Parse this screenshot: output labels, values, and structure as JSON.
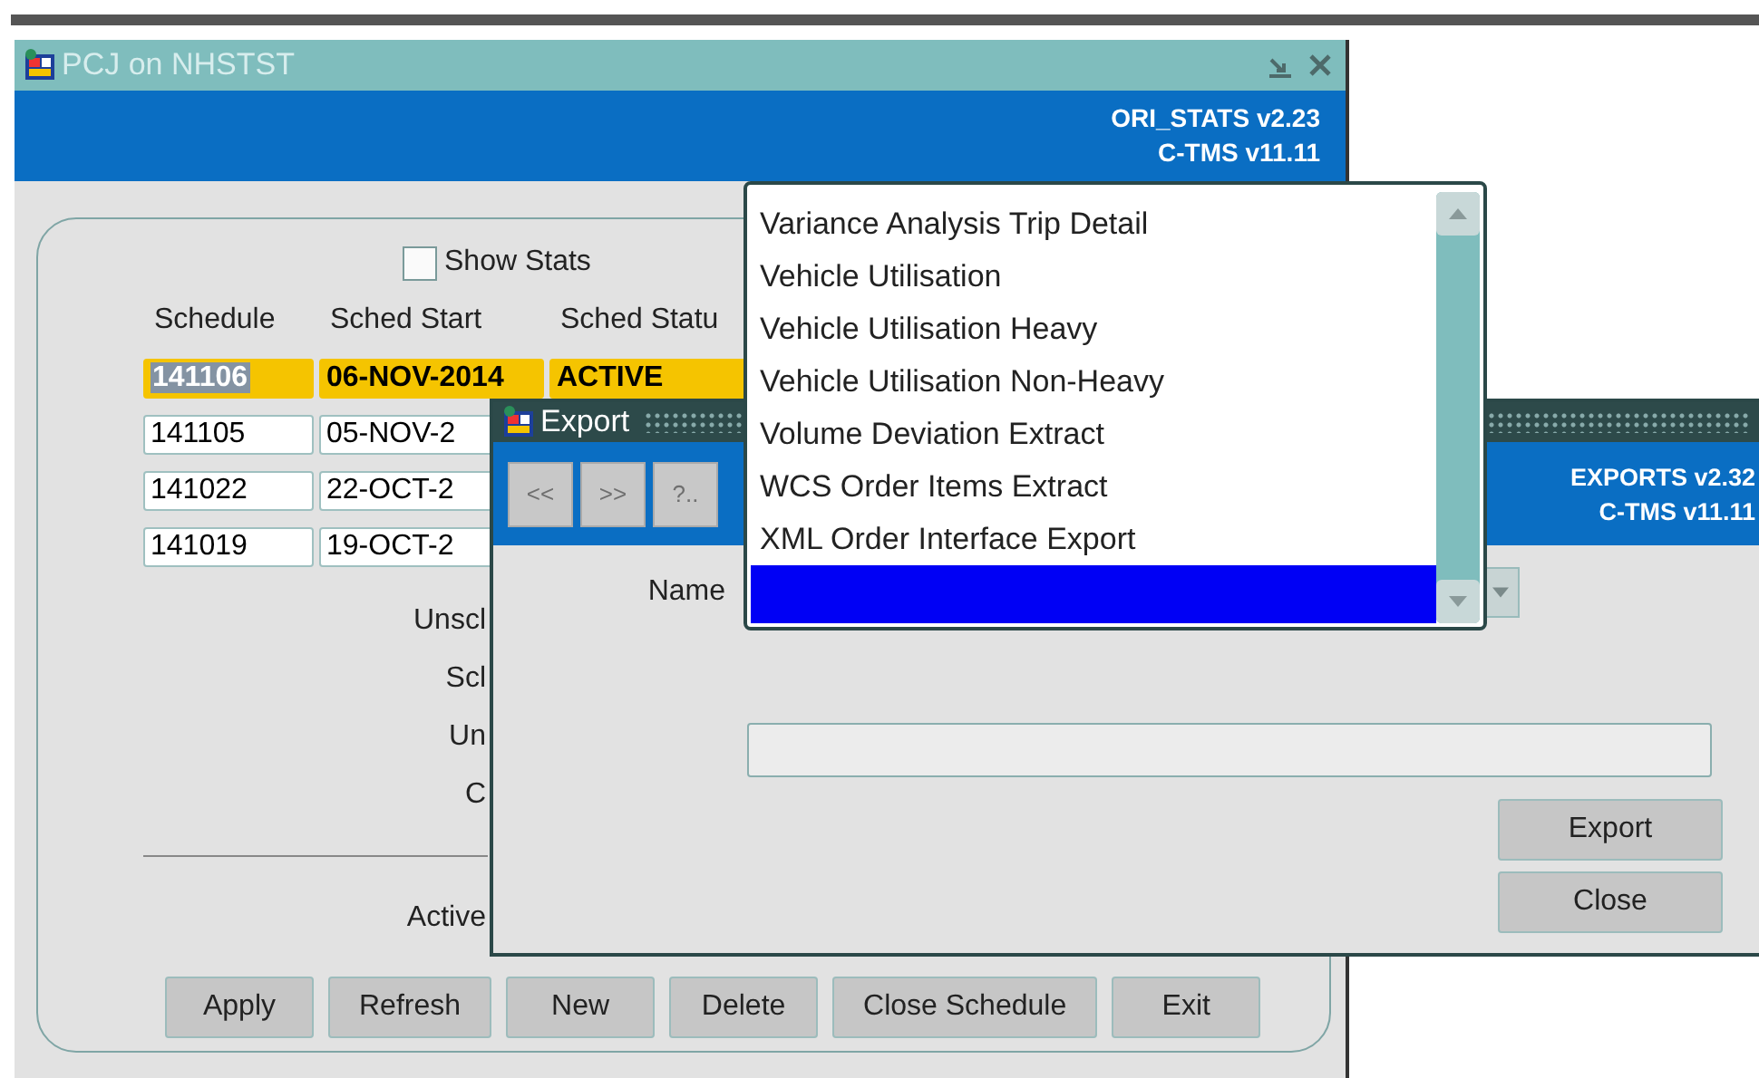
{
  "main_window": {
    "title": "PCJ on NHSTST",
    "header_lines": [
      "ORI_STATS v2.23",
      "C-TMS v11.11"
    ],
    "show_stats": {
      "label": "Show Stats",
      "checked": false
    },
    "columns": [
      "Schedule",
      "Sched Start",
      "Sched Statu"
    ],
    "rows": [
      {
        "schedule": "141106",
        "start": "06-NOV-2014",
        "status": "ACTIVE",
        "selected": true
      },
      {
        "schedule": "141105",
        "start": "05-NOV-2",
        "selected": false
      },
      {
        "schedule": "141022",
        "start": "22-OCT-2",
        "selected": false
      },
      {
        "schedule": "141019",
        "start": "19-OCT-2",
        "selected": false
      }
    ],
    "field_labels": [
      "Unscl",
      "Scl",
      "Un",
      "C"
    ],
    "summary_label": "Active",
    "buttons": [
      "Apply",
      "Refresh",
      "New",
      "Delete",
      "Close Schedule",
      "Exit"
    ]
  },
  "export_window": {
    "title": "Export",
    "toolbar_buttons": [
      "<<",
      ">>",
      "?.."
    ],
    "header_lines": [
      "EXPORTS v2.32",
      "C-TMS v11.11"
    ],
    "name_label": "Name",
    "buttons": [
      "Export",
      "Close"
    ]
  },
  "dropdown": {
    "items": [
      {
        "label": "Variance Analysis Trip Detail",
        "selected": false
      },
      {
        "label": "Vehicle Utilisation",
        "selected": false
      },
      {
        "label": "Vehicle Utilisation Heavy",
        "selected": false
      },
      {
        "label": "Vehicle Utilisation Non-Heavy",
        "selected": false
      },
      {
        "label": "Volume Deviation Extract",
        "selected": false
      },
      {
        "label": "WCS Order Items Extract",
        "selected": false
      },
      {
        "label": "XML Order Interface Export",
        "selected": false
      },
      {
        "selected": true
      }
    ]
  }
}
